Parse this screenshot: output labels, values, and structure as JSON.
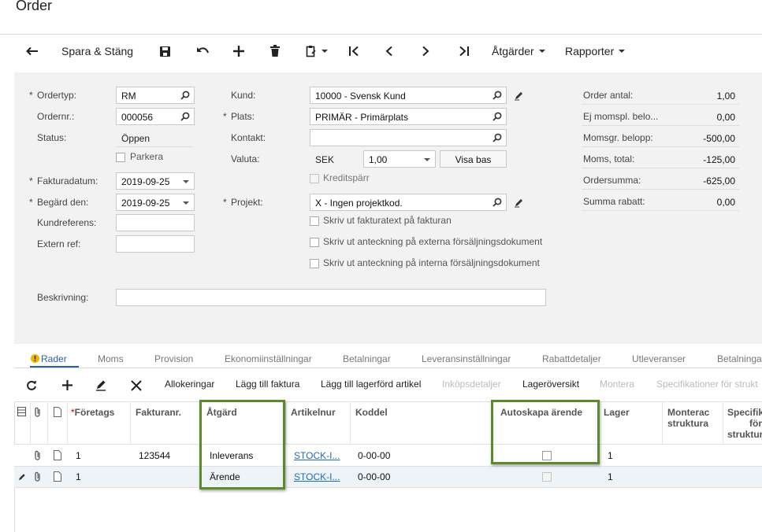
{
  "page": {
    "title": "Order"
  },
  "toolbar": {
    "save_close": "Spara & Stäng",
    "actions": "Åtgärder",
    "reports": "Rapporter"
  },
  "form": {
    "ordertype": {
      "label": "Ordertyp:",
      "value": "RM"
    },
    "orderno": {
      "label": "Ordernr.:",
      "value": "000056"
    },
    "status": {
      "label": "Status:",
      "value": "Öppen"
    },
    "hold": {
      "label": "Parkera"
    },
    "invoice_date": {
      "label": "Fakturadatum:",
      "value": "2019-09-25"
    },
    "requested_on": {
      "label": "Begärd den:",
      "value": "2019-09-25"
    },
    "customer_ref": {
      "label": "Kundreferens:",
      "value": ""
    },
    "external_ref": {
      "label": "Extern ref:",
      "value": ""
    },
    "customer": {
      "label": "Kund:",
      "value": "10000 - Svensk Kund"
    },
    "location": {
      "label": "Plats:",
      "value": "PRIMÄR - Primärplats"
    },
    "contact": {
      "label": "Kontakt:",
      "value": ""
    },
    "currency": {
      "label": "Valuta:",
      "code": "SEK",
      "rate": "1,00",
      "view_base": "Visa bas"
    },
    "credit_hold": {
      "label": "Kreditspärr"
    },
    "project": {
      "label": "Projekt:",
      "value": "X - Ingen projektkod."
    },
    "print_invoice_text": "Skriv ut fakturatext på fakturan",
    "print_note_external": "Skriv ut anteckning på externa försäljningsdokument",
    "print_note_internal": "Skriv ut anteckning på interna försäljningsdokument",
    "description": {
      "label": "Beskrivning:",
      "value": ""
    }
  },
  "totals": [
    {
      "label": "Order antal:",
      "value": "1,00"
    },
    {
      "label": "Ej momspl. belo...",
      "value": "0,00"
    },
    {
      "label": "Momsgr. belopp:",
      "value": "-500,00"
    },
    {
      "label": "Moms, total:",
      "value": "-125,00"
    },
    {
      "label": "Ordersumma:",
      "value": "-625,00"
    },
    {
      "label": "Summa rabatt:",
      "value": "0,00"
    }
  ],
  "tabs": [
    "Rader",
    "Moms",
    "Provision",
    "Ekonomiinställningar",
    "Betalningar",
    "Leveransinställningar",
    "Rabattdetaljer",
    "Utleveranser",
    "Betalninga"
  ],
  "grid_toolbar": {
    "allocations": "Allokeringar",
    "add_invoice": "Lägg till faktura",
    "add_stock_item": "Lägg till lagerförd artikel",
    "purchase_details": "Inköpsdetaljer",
    "inventory_summary": "Lageröversikt",
    "assembly": "Montera",
    "specs": "Specifikationer för strukt"
  },
  "grid": {
    "headers": {
      "company": "Företags",
      "invoice_no": "Fakturanr.",
      "action": "Åtgärd",
      "item_no": "Artikelnur",
      "account_code": "Koddel",
      "auto_create_case": "Autoskapa ärende",
      "warehouse": "Lager",
      "assembly_structure": "Monterac\nstruktura",
      "specs_structure": "Specifik\nför\nstruktur"
    },
    "rows": [
      {
        "company": "1",
        "invoice_no": "123544",
        "action": "Inleverans",
        "item": "STOCK-I...",
        "code": "0-00-00",
        "warehouse": "1"
      },
      {
        "company": "1",
        "invoice_no": "",
        "action": "Ärende",
        "item": "STOCK-I...",
        "code": "0-00-00",
        "warehouse": "1"
      }
    ]
  },
  "colors": {
    "accent": "#2a5fa8",
    "highlight": "#5a8a2a",
    "link": "#1f6cb5"
  }
}
